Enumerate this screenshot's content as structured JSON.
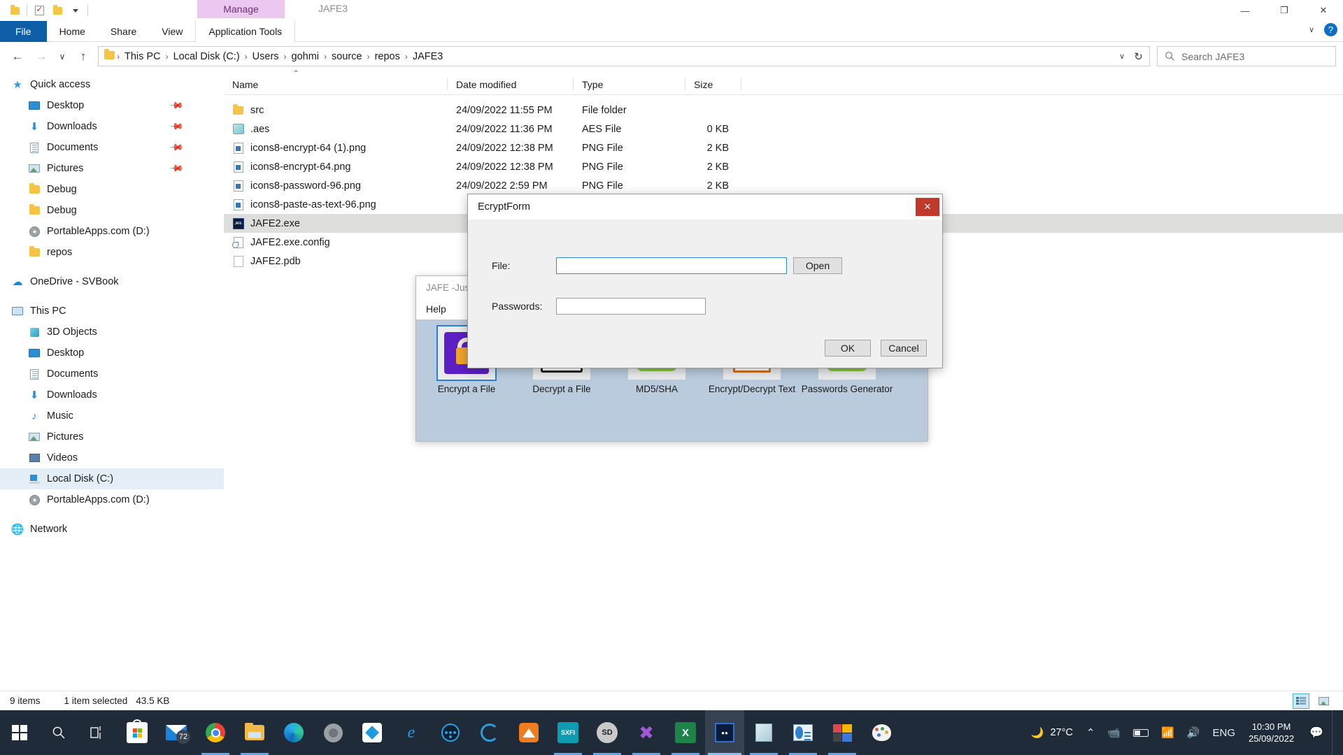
{
  "window": {
    "app_title": "JAFE3",
    "contextual_tab_group": "Manage",
    "minimize": "—",
    "maximize": "❐",
    "close": "✕",
    "ribbon_collapse": "∨",
    "help": "?"
  },
  "quick_access_toolbar": {
    "items": [
      {
        "name": "folder-properties-icon",
        "label": ""
      },
      {
        "name": "properties-icon",
        "label": ""
      },
      {
        "name": "new-folder-icon",
        "label": ""
      },
      {
        "name": "customize-qat-icon",
        "label": ""
      }
    ]
  },
  "ribbon": {
    "tabs": [
      {
        "label": "File",
        "active": true
      },
      {
        "label": "Home",
        "active": false
      },
      {
        "label": "Share",
        "active": false
      },
      {
        "label": "View",
        "active": false
      },
      {
        "label": "Application Tools",
        "active": false
      }
    ]
  },
  "address_bar": {
    "back": "←",
    "forward": "→",
    "recent": "∨",
    "up": "↑",
    "breadcrumbs": [
      "This PC",
      "Local Disk (C:)",
      "Users",
      "gohmi",
      "source",
      "repos",
      "JAFE3"
    ],
    "separator": "›",
    "dropdown": "∨",
    "refresh": "↻"
  },
  "search": {
    "placeholder": "Search JAFE3",
    "icon": "search-icon"
  },
  "sidebar": {
    "groups": [
      {
        "header": {
          "label": "Quick access",
          "icon": "star-icon"
        },
        "items": [
          {
            "label": "Desktop",
            "icon": "desktop-icon",
            "pinned": true
          },
          {
            "label": "Downloads",
            "icon": "download-icon",
            "pinned": true
          },
          {
            "label": "Documents",
            "icon": "documents-icon",
            "pinned": true
          },
          {
            "label": "Pictures",
            "icon": "pictures-icon",
            "pinned": true
          },
          {
            "label": "Debug",
            "icon": "folder-icon",
            "pinned": false
          },
          {
            "label": "Debug",
            "icon": "folder-icon",
            "pinned": false
          },
          {
            "label": "PortableApps.com (D:)",
            "icon": "disc-icon",
            "pinned": false
          },
          {
            "label": "repos",
            "icon": "folder-icon",
            "pinned": false
          }
        ]
      },
      {
        "header": {
          "label": "OneDrive - SVBook",
          "icon": "cloud-icon"
        },
        "items": []
      },
      {
        "header": {
          "label": "This PC",
          "icon": "pc-icon"
        },
        "items": [
          {
            "label": "3D Objects",
            "icon": "cube-icon",
            "pinned": false
          },
          {
            "label": "Desktop",
            "icon": "desktop-icon",
            "pinned": false
          },
          {
            "label": "Documents",
            "icon": "documents-icon",
            "pinned": false
          },
          {
            "label": "Downloads",
            "icon": "download-icon",
            "pinned": false
          },
          {
            "label": "Music",
            "icon": "music-icon",
            "pinned": false
          },
          {
            "label": "Pictures",
            "icon": "pictures-icon",
            "pinned": false
          },
          {
            "label": "Videos",
            "icon": "video-icon",
            "pinned": false
          },
          {
            "label": "Local Disk (C:)",
            "icon": "harddrive-icon",
            "pinned": false,
            "selected": true
          },
          {
            "label": "PortableApps.com (D:)",
            "icon": "disc-icon",
            "pinned": false
          }
        ]
      },
      {
        "header": {
          "label": "Network",
          "icon": "network-icon"
        },
        "items": []
      }
    ]
  },
  "file_list": {
    "columns": [
      {
        "label": "Name",
        "sorted": true,
        "sort_caret": "⌃"
      },
      {
        "label": "Date modified"
      },
      {
        "label": "Type"
      },
      {
        "label": "Size"
      }
    ],
    "rows": [
      {
        "name": "src",
        "date": "24/09/2022 11:55 PM",
        "type": "File folder",
        "size": "",
        "icon": "folder-icon",
        "selected": false
      },
      {
        "name": ".aes",
        "date": "24/09/2022 11:36 PM",
        "type": "AES File",
        "size": "0 KB",
        "icon": "aes-file-icon",
        "selected": false
      },
      {
        "name": "icons8-encrypt-64 (1).png",
        "date": "24/09/2022 12:38 PM",
        "type": "PNG File",
        "size": "2 KB",
        "icon": "png-file-icon",
        "selected": false
      },
      {
        "name": "icons8-encrypt-64.png",
        "date": "24/09/2022 12:38 PM",
        "type": "PNG File",
        "size": "2 KB",
        "icon": "png-file-icon",
        "selected": false
      },
      {
        "name": "icons8-password-96.png",
        "date": "24/09/2022 2:59 PM",
        "type": "PNG File",
        "size": "2 KB",
        "icon": "png-file-icon",
        "selected": false
      },
      {
        "name": "icons8-paste-as-text-96.png",
        "date": "",
        "type": "",
        "size": "",
        "icon": "png-file-icon",
        "selected": false
      },
      {
        "name": "JAFE2.exe",
        "date": "",
        "type": "",
        "size": "",
        "icon": "exe-file-icon",
        "selected": true
      },
      {
        "name": "JAFE2.exe.config",
        "date": "",
        "type": "",
        "size": "",
        "icon": "config-file-icon",
        "selected": false
      },
      {
        "name": "JAFE2.pdb",
        "date": "",
        "type": "",
        "size": "",
        "icon": "pdb-file-icon",
        "selected": false
      }
    ]
  },
  "status_bar": {
    "item_count": "9 items",
    "selection": "1 item selected",
    "selection_size": "43.5 KB",
    "view_details_icon": "details-view-icon",
    "view_large_icons_icon": "large-icons-view-icon"
  },
  "jafe_app": {
    "title": "JAFE -Just",
    "menu": [
      "Help"
    ],
    "tools": [
      {
        "label": "Encrypt a File",
        "icon": "padlock-icon",
        "selected": true
      },
      {
        "label": "Decrypt a File",
        "icon": "open-padlock-icon",
        "selected": false
      },
      {
        "label": "MD5/SHA",
        "icon": "green-dots-icon",
        "selected": false
      },
      {
        "label": "Encrypt/Decrypt Text",
        "icon": "text-cursor-icon",
        "selected": false
      },
      {
        "label": "Passwords Generator",
        "icon": "green-dots-icon",
        "selected": false
      }
    ]
  },
  "dialog": {
    "title": "EcryptForm",
    "close_label": "✕",
    "file_label": "File:",
    "file_value": "",
    "file_placeholder": "",
    "open_button": "Open",
    "passwords_label": "Passwords:",
    "passwords_value": "",
    "passwords_placeholder": "",
    "ok_button": "OK",
    "cancel_button": "Cancel"
  },
  "taskbar": {
    "start_icon": "windows-start-icon",
    "items": [
      {
        "name": "search-taskbar-icon",
        "glyph": "⌕",
        "running": false,
        "active": false
      },
      {
        "name": "task-view-icon",
        "glyph": "⌸",
        "running": false,
        "active": false
      },
      {
        "name": "microsoft-store-icon",
        "glyph": "",
        "running": false,
        "active": false
      },
      {
        "name": "mail-icon",
        "glyph": "",
        "badge": "72",
        "running": false,
        "active": false
      },
      {
        "name": "google-chrome-icon",
        "glyph": "",
        "running": true,
        "active": false
      },
      {
        "name": "file-explorer-icon",
        "glyph": "",
        "running": true,
        "active": false
      },
      {
        "name": "microsoft-edge-icon",
        "glyph": "",
        "running": false,
        "active": false
      },
      {
        "name": "grey-swirl-app-icon",
        "glyph": "",
        "running": false,
        "active": false
      },
      {
        "name": "blue-diamond-app-icon",
        "glyph": "",
        "running": false,
        "active": false
      },
      {
        "name": "internet-explorer-icon",
        "glyph": "",
        "running": false,
        "active": false
      },
      {
        "name": "blue-circle-dots-icon",
        "glyph": "",
        "running": false,
        "active": false
      },
      {
        "name": "blue-c-app-icon",
        "glyph": "",
        "running": false,
        "active": false
      },
      {
        "name": "orange-triangle-app-icon",
        "glyph": "",
        "running": false,
        "active": false
      },
      {
        "name": "sxfi-control-icon",
        "glyph": "SXFI",
        "running": true,
        "active": false
      },
      {
        "name": "sd-gear-icon",
        "glyph": "SD",
        "running": true,
        "active": false
      },
      {
        "name": "visual-studio-icon",
        "glyph": "",
        "running": true,
        "active": false
      },
      {
        "name": "microsoft-excel-icon",
        "glyph": "X",
        "running": true,
        "active": false
      },
      {
        "name": "jafe-app-icon",
        "glyph": "",
        "running": true,
        "active": true
      },
      {
        "name": "notepad-icon",
        "glyph": "",
        "running": true,
        "active": false
      },
      {
        "name": "presentation-app-icon",
        "glyph": "",
        "running": true,
        "active": false
      },
      {
        "name": "color-palette-app-icon",
        "glyph": "",
        "running": true,
        "active": false
      },
      {
        "name": "paint-icon",
        "glyph": "",
        "running": false,
        "active": false
      }
    ],
    "tray": {
      "weather_icon": "moon-cloud-icon",
      "temperature": "27°C",
      "overflow_icon": "⌃",
      "meet_now_icon": "camera-icon",
      "battery_icon": "battery-icon",
      "network_icon": "wifi-icon",
      "volume_icon": "speaker-icon",
      "language": "ENG",
      "time": "10:30 PM",
      "date": "25/09/2022",
      "notifications_icon": "notification-icon"
    }
  }
}
